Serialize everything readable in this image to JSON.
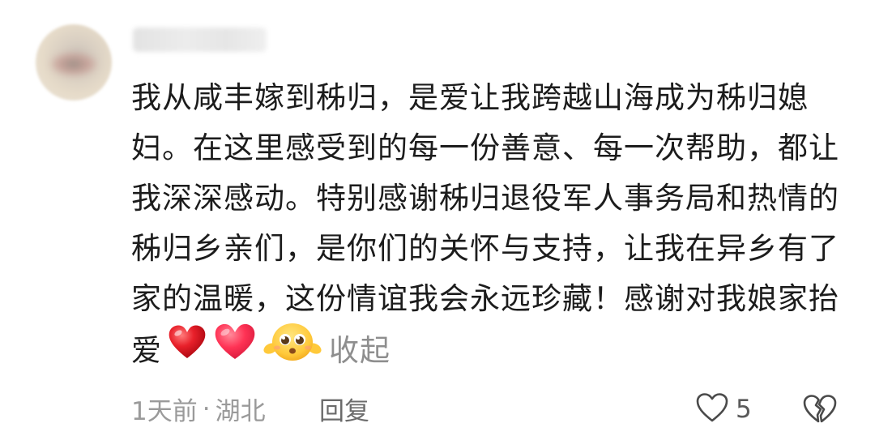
{
  "comment": {
    "text": "我从咸丰嫁到秭归，是爱让我跨越山海成为秭归媳妇。在这里感受到的每一份善意、每一次帮助，都让我深深感动。特别感谢秭归退役军人事务局和热情的秭归乡亲们，是你们的关怀与支持，让我在异乡有了家的温暖，这份情谊我会永远珍藏！感谢对我娘家抬爱",
    "emojis": [
      "red-heart-emoji",
      "pink-heart-emoji",
      "pleading-face-emoji"
    ],
    "collapse_label": "收起",
    "time": "1天前",
    "separator": "·",
    "location": "湖北",
    "reply_label": "回复",
    "like_count": "5"
  },
  "colors": {
    "text": "#1c1c1c",
    "meta": "#9a9a9a",
    "heart_red": "#e8202a",
    "heart_pink": "#ff3355"
  }
}
